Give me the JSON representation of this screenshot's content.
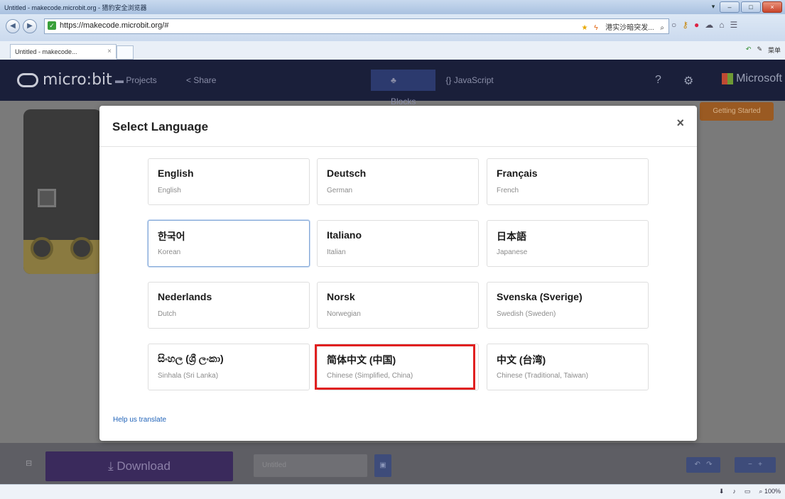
{
  "browser": {
    "window_title": "Untitled - makecode.microbit.org - 猎豹安全浏览器",
    "url": "https://makecode.microbit.org/#",
    "address_extra": "港实沙暗突发...",
    "tab_label": "Untitled - makecode...",
    "tab_close": "×",
    "menu_label": "菜单",
    "status_zoom": "100%"
  },
  "app": {
    "logo": "micro:bit",
    "nav": {
      "projects": "Projects",
      "share": "Share"
    },
    "modes": {
      "blocks": "Blocks",
      "javascript": "{} JavaScript"
    },
    "help_icon": "?",
    "settings_icon": "⚙",
    "brand": "Microsoft",
    "getting_started": "Getting Started",
    "download_label": "Download",
    "project_name": "Untitled",
    "icons": {
      "download": "download-icon",
      "save": "save-icon",
      "undo": "undo-icon",
      "redo": "redo-icon",
      "zoom-in": "zoom-in-icon",
      "zoom-out": "zoom-out-icon"
    }
  },
  "modal": {
    "title": "Select Language",
    "close": "×",
    "languages": [
      {
        "name": "English",
        "english": "English"
      },
      {
        "name": "Deutsch",
        "english": "German"
      },
      {
        "name": "Français",
        "english": "French"
      },
      {
        "name": "한국어",
        "english": "Korean"
      },
      {
        "name": "Italiano",
        "english": "Italian"
      },
      {
        "name": "日本語",
        "english": "Japanese"
      },
      {
        "name": "Nederlands",
        "english": "Dutch"
      },
      {
        "name": "Norsk",
        "english": "Norwegian"
      },
      {
        "name": "Svenska (Sverige)",
        "english": "Swedish (Sweden)"
      },
      {
        "name": "සිංහල (ශ්‍රී ලංකා)",
        "english": "Sinhala (Sri Lanka)"
      },
      {
        "name": "简体中文 (中国)",
        "english": "Chinese (Simplified, China)"
      },
      {
        "name": "中文 (台湾)",
        "english": "Chinese (Traditional, Taiwan)"
      }
    ],
    "focused_index": 3,
    "highlighted_index": 10,
    "help_link": "Help us translate"
  },
  "colors": {
    "header_bg": "#1a1f3a",
    "download_bg": "#3a2a5c",
    "highlight": "#e02020",
    "link": "#1f62b8"
  }
}
